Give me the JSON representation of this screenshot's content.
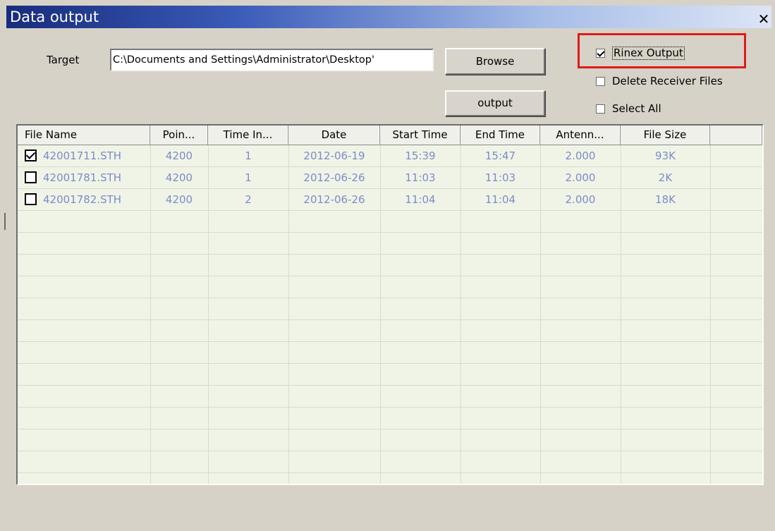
{
  "window": {
    "title": "Data output",
    "close_symbol": "✕"
  },
  "target": {
    "label": "Target",
    "path": "C:\\Documents and Settings\\Administrator\\Desktop'"
  },
  "buttons": {
    "browse": "Browse",
    "output": "output"
  },
  "options": {
    "rinex_output": {
      "label": "Rinex Output",
      "checked": true
    },
    "delete_receiver_files": {
      "label": "Delete Receiver Files",
      "checked": false
    },
    "select_all": {
      "label": "Select All",
      "checked": false
    }
  },
  "table": {
    "columns": [
      "File Name",
      "Poin...",
      "Time In...",
      "Date",
      "Start Time",
      "End Time",
      "Antenn...",
      "File Size"
    ],
    "rows": [
      {
        "checked": true,
        "cells": [
          "42001711.STH",
          "4200",
          "1",
          "2012-06-19",
          "15:39",
          "15:47",
          "2.000",
          "93K"
        ]
      },
      {
        "checked": false,
        "cells": [
          "42001781.STH",
          "4200",
          "1",
          "2012-06-26",
          "11:03",
          "11:03",
          "2.000",
          "2K"
        ]
      },
      {
        "checked": false,
        "cells": [
          "42001782.STH",
          "4200",
          "2",
          "2012-06-26",
          "11:04",
          "11:04",
          "2.000",
          "18K"
        ]
      }
    ]
  },
  "colors": {
    "highlight_border": "#e01a1a",
    "row_text": "#7d8bc8",
    "grid_background": "#f0f4e7"
  }
}
